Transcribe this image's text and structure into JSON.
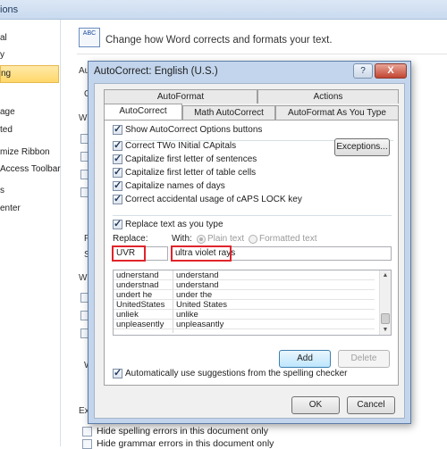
{
  "background": {
    "title_fragment": "ions",
    "sidebar": [
      {
        "label": "al",
        "selected": false
      },
      {
        "label": "y",
        "selected": false
      },
      {
        "label": "ng",
        "selected": true
      },
      {
        "label": "age",
        "selected": false
      },
      {
        "label": "ted",
        "selected": false
      },
      {
        "label": "mize Ribbon",
        "selected": false
      },
      {
        "label": "Access Toolbar",
        "selected": false
      },
      {
        "label": "s",
        "selected": false
      },
      {
        "label": "enter",
        "selected": false
      }
    ],
    "header_icon_text": "ABC",
    "header_text": "Change how Word corrects and formats your text.",
    "fragments": [
      "Au",
      "C",
      "Wh",
      "Fr",
      "Sp",
      "Wh",
      "W",
      "Ex"
    ],
    "bottom_options": [
      "Hide spelling errors in this document only",
      "Hide grammar errors in this document only"
    ]
  },
  "dialog": {
    "title": "AutoCorrect: English (U.S.)",
    "help_label": "?",
    "close_label": "X",
    "tabs_row1": [
      "AutoFormat",
      "Actions"
    ],
    "tabs_row2": [
      "AutoCorrect",
      "Math AutoCorrect",
      "AutoFormat As You Type"
    ],
    "active_tab": "AutoCorrect",
    "show_buttons_option": "Show AutoCorrect Options buttons",
    "options": [
      {
        "label": "Correct TWo INitial CApitals",
        "checked": true
      },
      {
        "label": "Capitalize first letter of sentences",
        "checked": true
      },
      {
        "label": "Capitalize first letter of table cells",
        "checked": true
      },
      {
        "label": "Capitalize names of days",
        "checked": true
      },
      {
        "label": "Correct accidental usage of cAPS LOCK key",
        "checked": true
      }
    ],
    "exceptions_button": "Exceptions...",
    "replace_as_you_type": "Replace text as you type",
    "replace_label": "Replace:",
    "with_label": "With:",
    "plain_text_label": "Plain text",
    "formatted_text_label": "Formatted text",
    "replace_value": "UVR",
    "with_value": "ultra violet rays",
    "entries": [
      {
        "from": "udnerstand",
        "to": "understand"
      },
      {
        "from": "understnad",
        "to": "understand"
      },
      {
        "from": "undert he",
        "to": "under the"
      },
      {
        "from": "UnitedStates",
        "to": "United States"
      },
      {
        "from": "unliek",
        "to": "unlike"
      },
      {
        "from": "unpleasently",
        "to": "unpleasantly"
      }
    ],
    "add_button": "Add",
    "delete_button": "Delete",
    "auto_suggest_option": "Automatically use suggestions from the spelling checker",
    "ok_button": "OK",
    "cancel_button": "Cancel"
  }
}
